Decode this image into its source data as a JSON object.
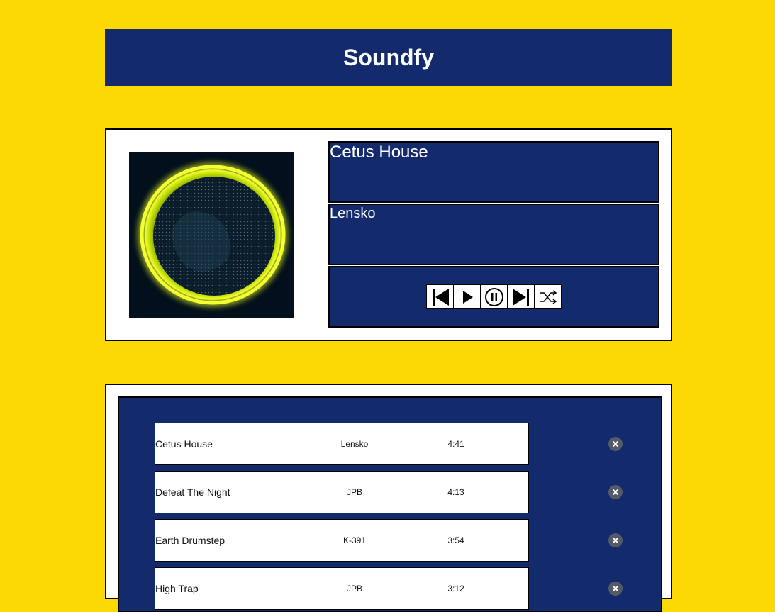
{
  "app": {
    "title": "Soundfy"
  },
  "now_playing": {
    "title": "Cetus House",
    "artist": "Lensko",
    "cover_icon": "glowing-sphere-cover",
    "controls": [
      {
        "name": "previous-button",
        "icon": "skip-previous-icon"
      },
      {
        "name": "play-button",
        "icon": "play-icon"
      },
      {
        "name": "pause-button",
        "icon": "pause-icon"
      },
      {
        "name": "next-button",
        "icon": "skip-next-icon"
      },
      {
        "name": "shuffle-button",
        "icon": "shuffle-icon"
      }
    ]
  },
  "playlist": {
    "tracks": [
      {
        "title": "Cetus House",
        "artist": "Lensko",
        "duration": "4:41"
      },
      {
        "title": "Defeat The Night",
        "artist": "JPB",
        "duration": "4:13"
      },
      {
        "title": "Earth Drumstep",
        "artist": "K-391",
        "duration": "3:54"
      },
      {
        "title": "High Trap",
        "artist": "JPB",
        "duration": "3:12"
      }
    ],
    "remove_icon": "close-circle-icon"
  },
  "colors": {
    "background": "#fcd903",
    "panel": "#132a6c",
    "text_light": "#ffffff",
    "accent_glow": "#e6ff2a"
  }
}
